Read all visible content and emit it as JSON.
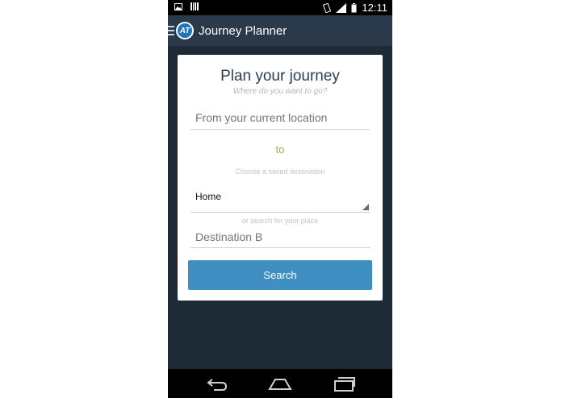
{
  "status_bar": {
    "time": "12:11",
    "icons": [
      "image-icon",
      "barcode-icon",
      "vibrate-icon",
      "signal-icon",
      "battery-icon"
    ]
  },
  "app_bar": {
    "title": "Journey Planner",
    "logo_text": "AT"
  },
  "card": {
    "title": "Plan your journey",
    "subtitle": "Where do you want to go?",
    "from_placeholder": "From your current location",
    "to_label": "to",
    "saved_hint": "Choose a saved destination",
    "saved_selected": "Home",
    "search_hint": "or search for your place",
    "destination_placeholder": "Destination B",
    "search_button": "Search"
  },
  "colors": {
    "app_bar": "#2b3a4b",
    "background": "#1e2a36",
    "button": "#3f8fc3",
    "to_label": "#8fb25a"
  },
  "nav_bar": {
    "icons": [
      "back-icon",
      "home-icon",
      "recents-icon"
    ]
  }
}
